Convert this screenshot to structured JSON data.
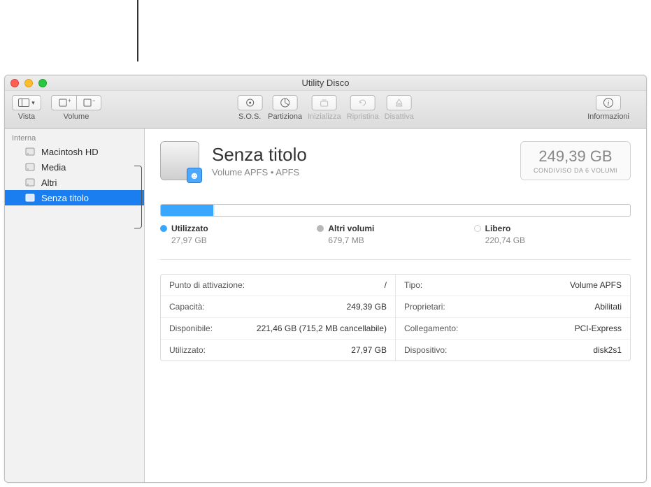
{
  "window": {
    "title": "Utility Disco"
  },
  "toolbar": {
    "view": {
      "label": "Vista"
    },
    "volume": {
      "label": "Volume"
    },
    "sos": {
      "label": "S.O.S."
    },
    "partition": {
      "label": "Partiziona"
    },
    "erase": {
      "label": "Inizializza"
    },
    "restore": {
      "label": "Ripristina"
    },
    "unmount": {
      "label": "Disattiva"
    },
    "info": {
      "label": "Informazioni"
    }
  },
  "sidebar": {
    "internal_header": "Interna",
    "items": [
      {
        "name": "Macintosh HD",
        "selected": false
      },
      {
        "name": "Media",
        "selected": false
      },
      {
        "name": "Altri",
        "selected": false
      },
      {
        "name": "Senza titolo",
        "selected": true
      }
    ]
  },
  "volume": {
    "name": "Senza titolo",
    "subtitle": "Volume APFS • APFS",
    "capacity": "249,39 GB",
    "shared_note": "CONDIVISO DA 6 VOLUMI"
  },
  "usage": {
    "used": {
      "label": "Utilizzato",
      "value": "27,97 GB"
    },
    "other": {
      "label": "Altri volumi",
      "value": "679,7 MB"
    },
    "free": {
      "label": "Libero",
      "value": "220,74 GB"
    }
  },
  "details": {
    "left": [
      {
        "k": "Punto di attivazione:",
        "v": "/"
      },
      {
        "k": "Capacità:",
        "v": "249,39 GB"
      },
      {
        "k": "Disponibile:",
        "v": "221,46 GB (715,2 MB cancellabile)"
      },
      {
        "k": "Utilizzato:",
        "v": "27,97 GB"
      }
    ],
    "right": [
      {
        "k": "Tipo:",
        "v": "Volume APFS"
      },
      {
        "k": "Proprietari:",
        "v": "Abilitati"
      },
      {
        "k": "Collegamento:",
        "v": "PCI-Express"
      },
      {
        "k": "Dispositivo:",
        "v": "disk2s1"
      }
    ]
  }
}
